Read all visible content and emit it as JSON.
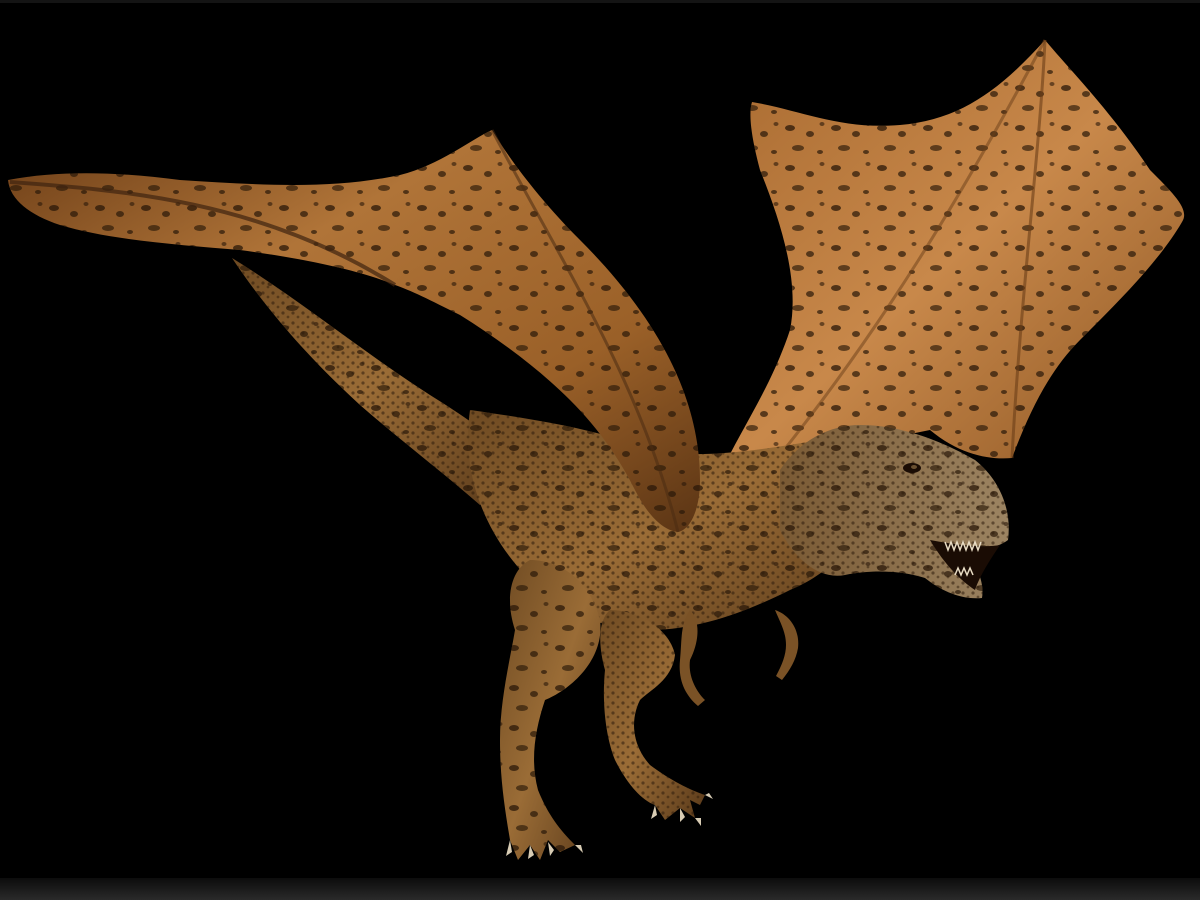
{
  "scene": {
    "subject": "winged-tyrannosaurus",
    "background_color": "#000000",
    "palette": {
      "wing_light": "#c08040",
      "wing_mid": "#9a5f28",
      "wing_dark": "#5a3414",
      "body_light": "#a8783e",
      "body_mid": "#7a5226",
      "body_dark": "#3e2610",
      "spot": "#2a1808",
      "teeth": "#e8dcc4",
      "claw": "#d8ccb4"
    }
  }
}
